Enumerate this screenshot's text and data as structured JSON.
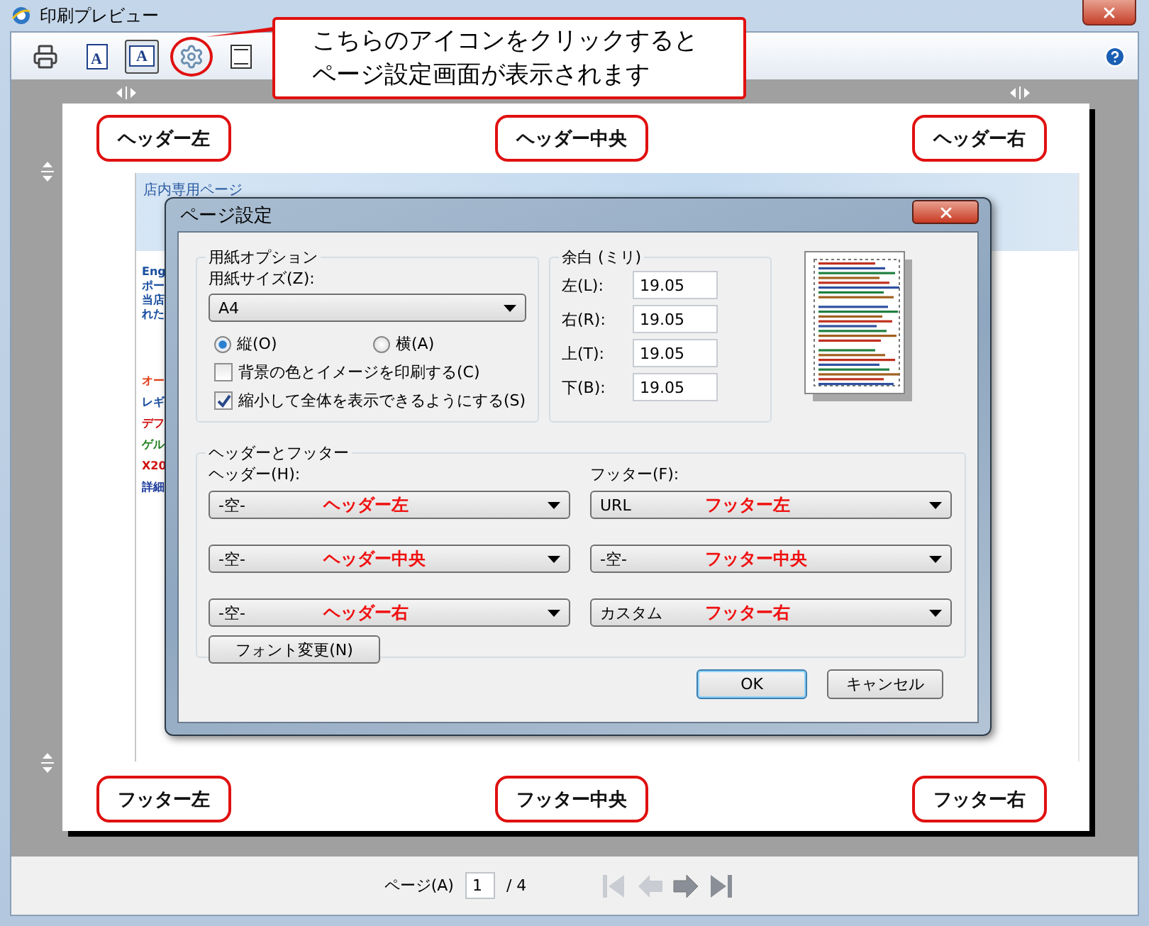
{
  "window": {
    "title": "印刷プレビュー"
  },
  "toolbar": {
    "buttons": [
      {
        "kind": "print",
        "selected": false
      },
      {
        "kind": "portrait",
        "label": "A",
        "selected": false
      },
      {
        "kind": "landscape",
        "label": "A",
        "selected": true
      },
      {
        "kind": "setup",
        "selected": false,
        "highlighted": true
      },
      {
        "kind": "page",
        "selected": false
      }
    ]
  },
  "callout": {
    "lines": [
      "こちらのアイコンをクリックすると",
      "ページ設定画面が表示されます"
    ]
  },
  "preview": {
    "header_labels": [
      "ヘッダー左",
      "ヘッダー中央",
      "ヘッダー右"
    ],
    "footer_labels": [
      "フッター左",
      "フッター中央",
      "フッター右"
    ],
    "webpage": {
      "title": "店内専用ページ",
      "groups": [
        [
          {
            "text": "Eng",
            "color": "#1a4fa0"
          },
          {
            "text": "ポー",
            "color": "#1a4fa0"
          },
          {
            "text": "当店",
            "color": "#1a4fa0"
          },
          {
            "text": "れた",
            "color": "#1a4fa0"
          }
        ],
        [
          {
            "text": "オー",
            "color": "#e0401a"
          },
          {
            "text": "レギ",
            "color": "#1a4fa0"
          },
          {
            "text": "デフ",
            "color": "#d01010"
          },
          {
            "text": "ゲル",
            "color": "#208020"
          },
          {
            "text": "X20",
            "color": "#d01010"
          },
          {
            "text": "詳細",
            "color": "#1a3a9a"
          }
        ]
      ]
    }
  },
  "dialog": {
    "title": "ページ設定",
    "paper": {
      "legend": "用紙オプション",
      "size_label": "用紙サイズ(Z):",
      "size_value": "A4",
      "orientation": [
        {
          "label": "縦(O)",
          "selected": true
        },
        {
          "label": "横(A)",
          "selected": false
        }
      ],
      "checkboxes": [
        {
          "label": "背景の色とイメージを印刷する(C)",
          "checked": false
        },
        {
          "label": "縮小して全体を表示できるようにする(S)",
          "checked": true
        }
      ]
    },
    "margins": {
      "legend": "余白 (ミリ)",
      "fields": [
        {
          "label": "左(L):",
          "value": "19.05"
        },
        {
          "label": "右(R):",
          "value": "19.05"
        },
        {
          "label": "上(T):",
          "value": "19.05"
        },
        {
          "label": "下(B):",
          "value": "19.05"
        }
      ]
    },
    "header_footer": {
      "legend": "ヘッダーとフッター",
      "header_label": "ヘッダー(H):",
      "footer_label": "フッター(F):",
      "header_fields": [
        {
          "value": "-空-",
          "note": "ヘッダー左"
        },
        {
          "value": "-空-",
          "note": "ヘッダー中央"
        },
        {
          "value": "-空-",
          "note": "ヘッダー右"
        }
      ],
      "footer_fields": [
        {
          "value": "URL",
          "note": "フッター左"
        },
        {
          "value": "-空-",
          "note": "フッター中央"
        },
        {
          "value": "カスタム",
          "note": "フッター右"
        }
      ],
      "font_button": "フォント変更(N)"
    },
    "buttons": [
      {
        "label": "OK",
        "default": true
      },
      {
        "label": "キャンセル",
        "default": false
      }
    ]
  },
  "pager": {
    "label": "ページ(A)",
    "value": "1",
    "total": "/ 4",
    "nav": [
      {
        "kind": "first",
        "disabled": true
      },
      {
        "kind": "prev",
        "disabled": true
      },
      {
        "kind": "next",
        "disabled": false
      },
      {
        "kind": "last",
        "disabled": false
      }
    ]
  }
}
